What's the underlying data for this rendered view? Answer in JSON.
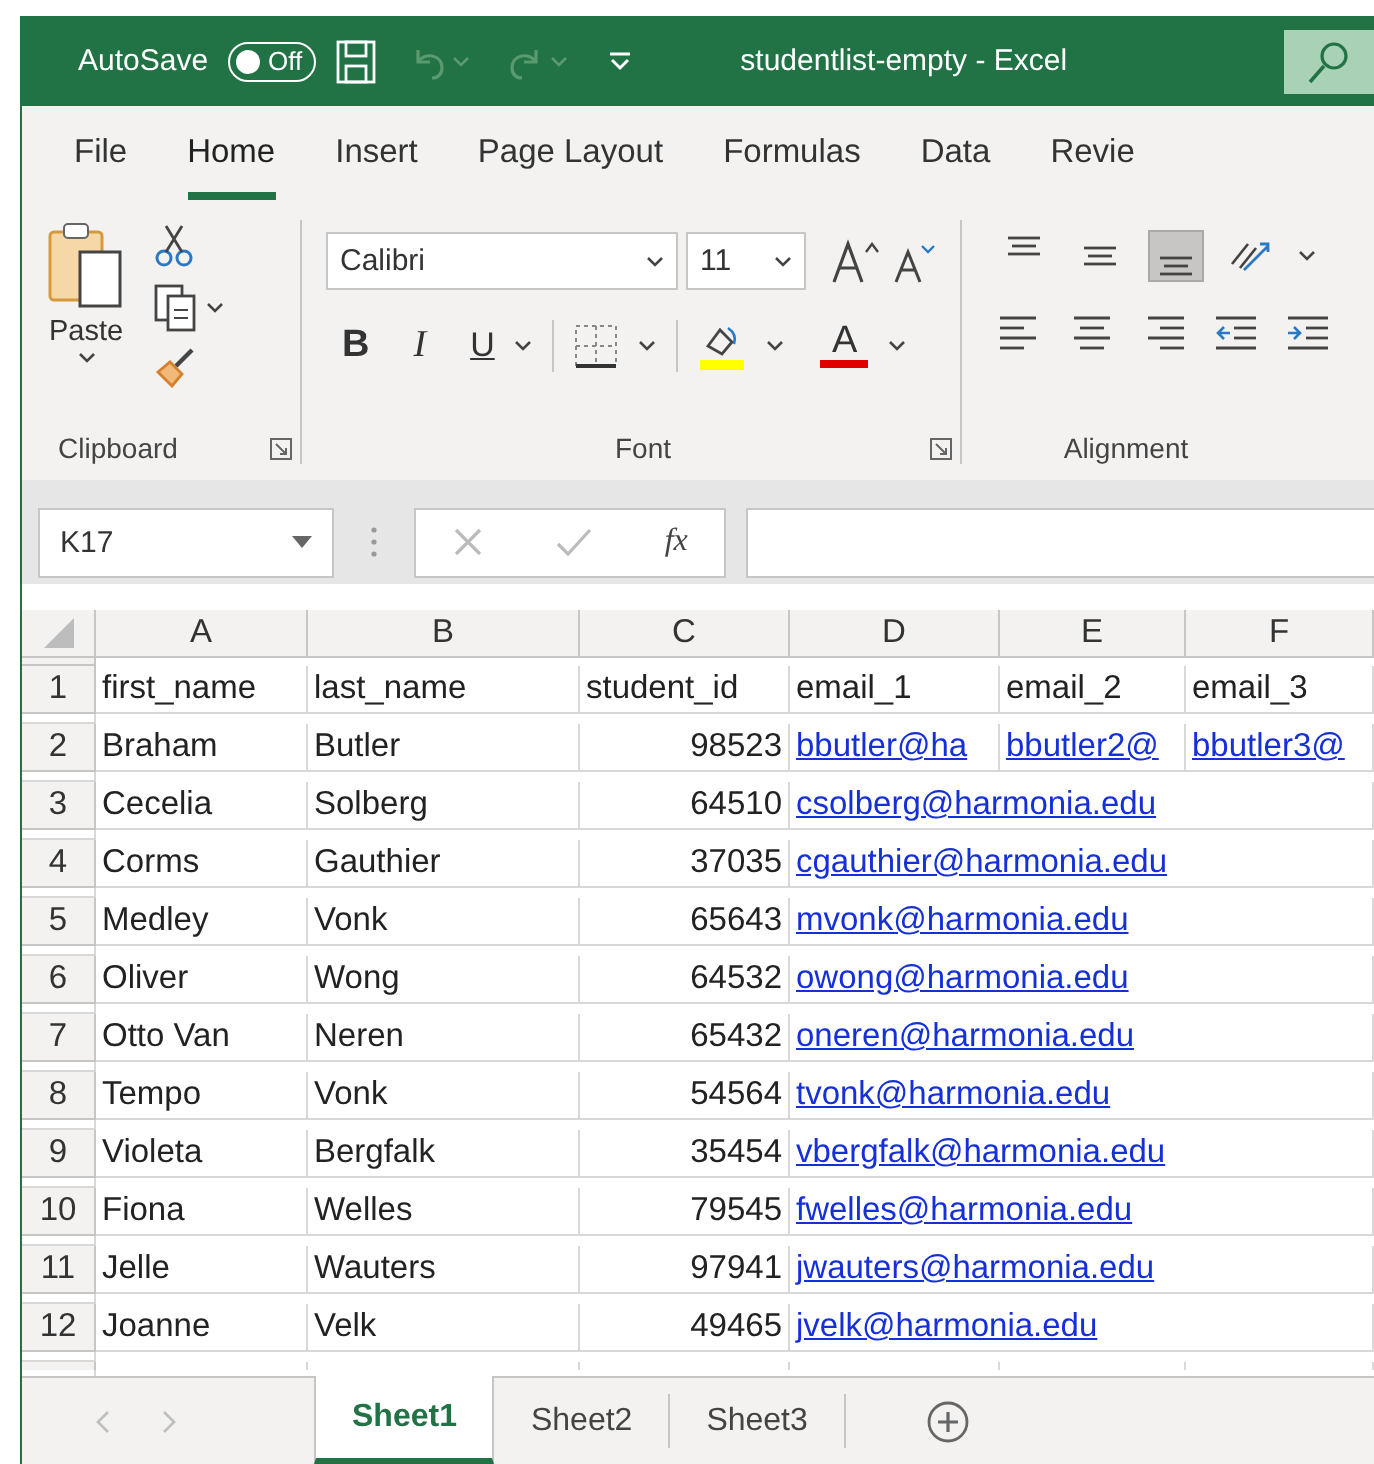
{
  "window": {
    "title": "studentlist-empty - Excel"
  },
  "quick_access": {
    "autosave_label": "AutoSave",
    "autosave": {
      "label": "Off",
      "on": false
    }
  },
  "ribbon_tabs": [
    {
      "label": "File",
      "selected": false
    },
    {
      "label": "Home",
      "selected": true
    },
    {
      "label": "Insert",
      "selected": false
    },
    {
      "label": "Page Layout",
      "selected": false
    },
    {
      "label": "Formulas",
      "selected": false
    },
    {
      "label": "Data",
      "selected": false
    },
    {
      "label": "Revie",
      "selected": false
    }
  ],
  "clipboard": {
    "paste_label": "Paste",
    "group_label": "Clipboard"
  },
  "font": {
    "name": "Calibri",
    "size": "11",
    "bold": "B",
    "italic": "I",
    "underline": "U",
    "color_letter": "A",
    "group_label": "Font"
  },
  "alignment": {
    "group_label": "Alignment",
    "vertical": [
      {
        "selected": false
      },
      {
        "selected": false
      },
      {
        "selected": true
      }
    ]
  },
  "formula_bar": {
    "name_box": "K17",
    "fx": "fx"
  },
  "columns": [
    "A",
    "B",
    "C",
    "D",
    "E",
    "F"
  ],
  "header_row": {
    "number": "1",
    "cells": [
      "first_name",
      "last_name",
      "student_id",
      "email_1",
      "email_2",
      "email_3"
    ]
  },
  "rows": [
    {
      "number": "2",
      "first_name": "Braham",
      "last_name": "Butler",
      "student_id": "98523",
      "emails": [
        "bbutler@ha",
        "bbutler2@",
        "bbutler3@"
      ]
    },
    {
      "number": "3",
      "first_name": "Cecelia",
      "last_name": "Solberg",
      "student_id": "64510",
      "emails": [
        "csolberg@harmonia.edu"
      ]
    },
    {
      "number": "4",
      "first_name": "Corms",
      "last_name": "Gauthier",
      "student_id": "37035",
      "emails": [
        "cgauthier@harmonia.edu"
      ]
    },
    {
      "number": "5",
      "first_name": "Medley",
      "last_name": "Vonk",
      "student_id": "65643",
      "emails": [
        "mvonk@harmonia.edu"
      ]
    },
    {
      "number": "6",
      "first_name": "Oliver",
      "last_name": "Wong",
      "student_id": "64532",
      "emails": [
        "owong@harmonia.edu"
      ]
    },
    {
      "number": "7",
      "first_name": "Otto Van",
      "last_name": "Neren",
      "student_id": "65432",
      "emails": [
        "oneren@harmonia.edu"
      ]
    },
    {
      "number": "8",
      "first_name": "Tempo",
      "last_name": "Vonk",
      "student_id": "54564",
      "emails": [
        "tvonk@harmonia.edu"
      ]
    },
    {
      "number": "9",
      "first_name": "Violeta",
      "last_name": "Bergfalk",
      "student_id": "35454",
      "emails": [
        "vbergfalk@harmonia.edu"
      ]
    },
    {
      "number": "10",
      "first_name": "Fiona",
      "last_name": "Welles",
      "student_id": "79545",
      "emails": [
        "fwelles@harmonia.edu"
      ]
    },
    {
      "number": "11",
      "first_name": "Jelle",
      "last_name": "Wauters",
      "student_id": "97941",
      "emails": [
        "jwauters@harmonia.edu"
      ]
    },
    {
      "number": "12",
      "first_name": "Joanne",
      "last_name": "Velk",
      "student_id": "49465",
      "emails": [
        "jvelk@harmonia.edu"
      ]
    }
  ],
  "sheet_tabs": [
    {
      "label": "Sheet1",
      "selected": true
    },
    {
      "label": "Sheet2",
      "selected": false
    },
    {
      "label": "Sheet3",
      "selected": false
    }
  ]
}
